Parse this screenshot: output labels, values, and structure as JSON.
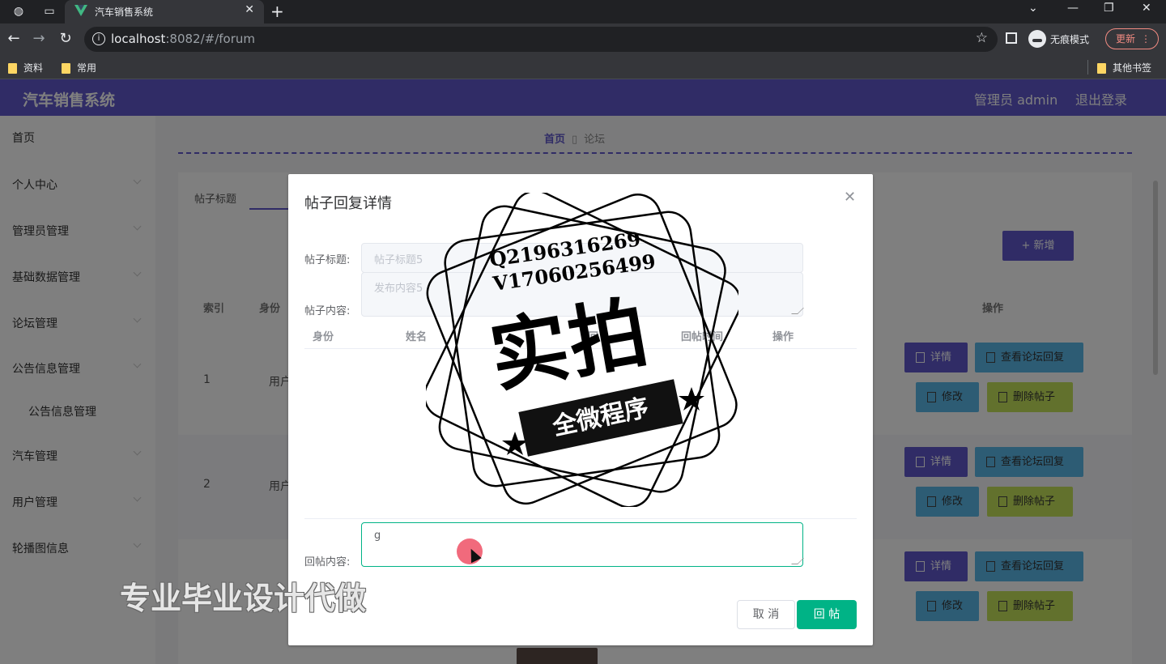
{
  "browser": {
    "tab_title": "汽车销售系统",
    "url_host": "localhost",
    "url_rest": ":8082/#/forum",
    "incognito_label": "无痕模式",
    "update_label": "更新",
    "bookmarks": [
      "资料",
      "常用"
    ],
    "other_bookmarks": "其他书签"
  },
  "app": {
    "title": "汽车销售系统",
    "user_label": "管理员 admin",
    "logout_label": "退出登录",
    "sidebar": [
      "首页",
      "个人中心",
      "管理员管理",
      "基础数据管理",
      "论坛管理",
      "公告信息管理",
      "公告信息管理",
      "汽车管理",
      "用户管理",
      "轮播图信息"
    ],
    "breadcrumb": {
      "home": "首页",
      "current": "论坛"
    },
    "search_label": "帖子标题",
    "add_label": "+ 新增",
    "table_headers": {
      "index": "索引",
      "role": "身份",
      "actions": "操作"
    },
    "rows": [
      {
        "index": "1",
        "role": "用户"
      },
      {
        "index": "2",
        "role": "用户"
      }
    ],
    "row_buttons": {
      "detail": "详情",
      "replies": "查看论坛回复",
      "edit": "修改",
      "delete": "删除帖子"
    }
  },
  "dialog": {
    "title": "帖子回复详情",
    "post_title_label": "帖子标题:",
    "post_title_value": "帖子标题5",
    "post_content_label": "帖子内容:",
    "post_content_value": "发布内容5",
    "reply_columns": [
      "身份",
      "姓名",
      "",
      "回",
      "回帖时间",
      "操作"
    ],
    "reply_label": "回帖内容:",
    "reply_value": "g",
    "cancel_label": "取 消",
    "submit_label": "回 帖"
  },
  "watermark": {
    "contact_q": "Q2196316269",
    "contact_v": "V17060256499",
    "stamp_main": "实拍",
    "stamp_ribbon": "全微程序",
    "banner": "专业毕业设计代做"
  },
  "colors": {
    "primary": "#6159cc",
    "success": "#00b386",
    "info": "#5bb8e8",
    "warning": "#c5e35a"
  }
}
